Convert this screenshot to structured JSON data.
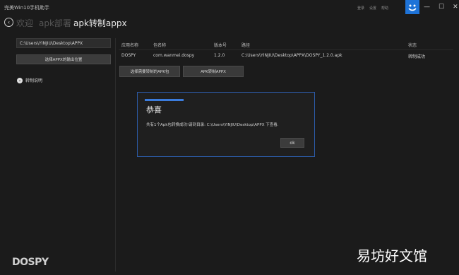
{
  "window": {
    "title": "完美Win10手机助手",
    "top_links": [
      "登录",
      "设置",
      "帮助"
    ],
    "controls": [
      "—",
      "☐",
      "✕"
    ]
  },
  "nav": {
    "back_icon": "back-arrow-icon",
    "crumbs": [
      "欢迎",
      "apk部署",
      "apk转制appx"
    ]
  },
  "left": {
    "path_value": "C:\\Users\\YINJIU\\Desktop\\APPX",
    "output_button": "选择APPX的输出位置",
    "instructions": "转制说明"
  },
  "table": {
    "headers": [
      "应用名称",
      "包名称",
      "版本号",
      "路径",
      "状态"
    ],
    "rows": [
      [
        "DOSPY",
        "com.wanmei.dospy",
        "1.2.0",
        "C:\\Users\\YINJIU\\Desktop\\APPX\\DOSPY_1.2.0.apk",
        "转制成功"
      ]
    ]
  },
  "buttons": {
    "select_apk": "选择需要转制的APK包",
    "convert": "APK转制APPX"
  },
  "dialog": {
    "title": "恭喜",
    "message": "共有1个Apk包转换成功!请到目录: C:\\Users\\YINJIU\\Desktop\\APPX 下查看.",
    "ok": "ok"
  },
  "footer": {
    "logo": "DOSPY",
    "watermark": "易坊好文馆"
  },
  "colors": {
    "accent": "#3b7cdd",
    "background": "#1b1b1b"
  }
}
